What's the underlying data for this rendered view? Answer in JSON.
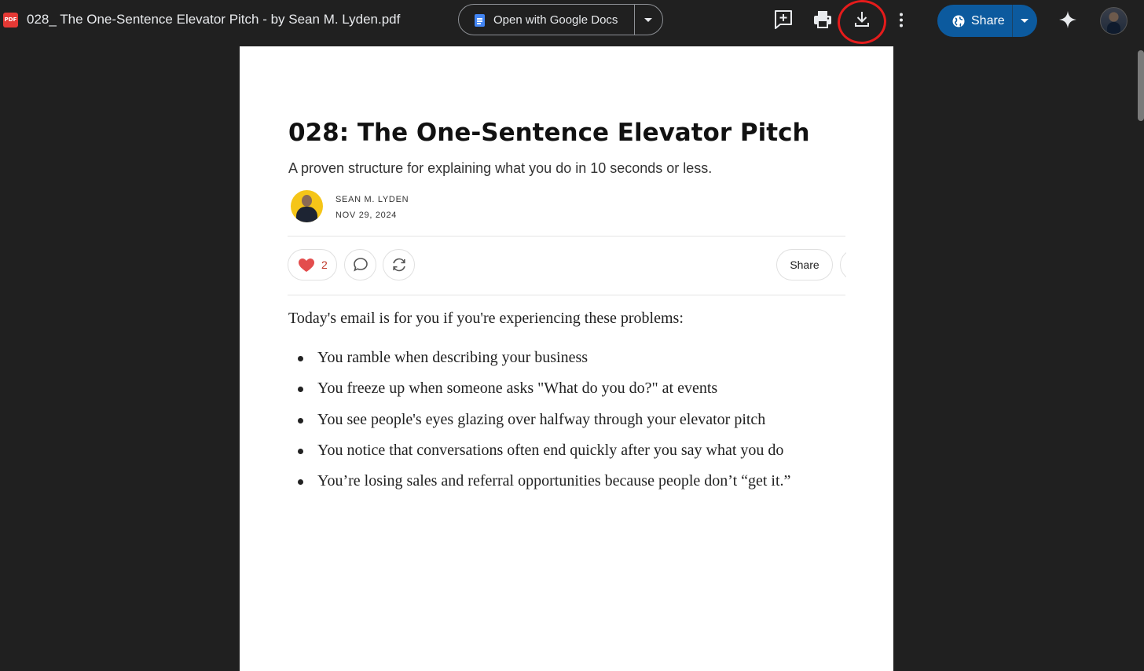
{
  "viewer": {
    "file_type_badge": "PDF",
    "file_title": "028_ The One-Sentence Elevator Pitch - by Sean M. Lyden.pdf",
    "open_with_label": "Open with Google Docs",
    "share_label": "Share",
    "toolbar_icons": [
      "add-comment-icon",
      "print-icon",
      "download-icon",
      "more-vert-icon",
      "gemini-sparkle-icon"
    ],
    "highlight_color": "#e51b1b",
    "share_color": "#0c5a9e"
  },
  "document": {
    "title": "028: The One-Sentence Elevator Pitch",
    "subtitle": "A proven structure for explaining what you do in 10 seconds or less.",
    "author": "SEAN M. LYDEN",
    "date": "NOV 29, 2024",
    "like_count": "2",
    "share_label": "Share",
    "intro": "Today's email is for you if you're experiencing these problems:",
    "bullets": [
      "You ramble when describing your business",
      "You freeze up when someone asks \"What do you do?\" at events",
      "You see people's eyes glazing over halfway through your elevator pitch",
      "You notice that conversations often end quickly after you say what you do",
      "You’re losing sales and referral opportunities because people don’t “get it.”"
    ]
  }
}
